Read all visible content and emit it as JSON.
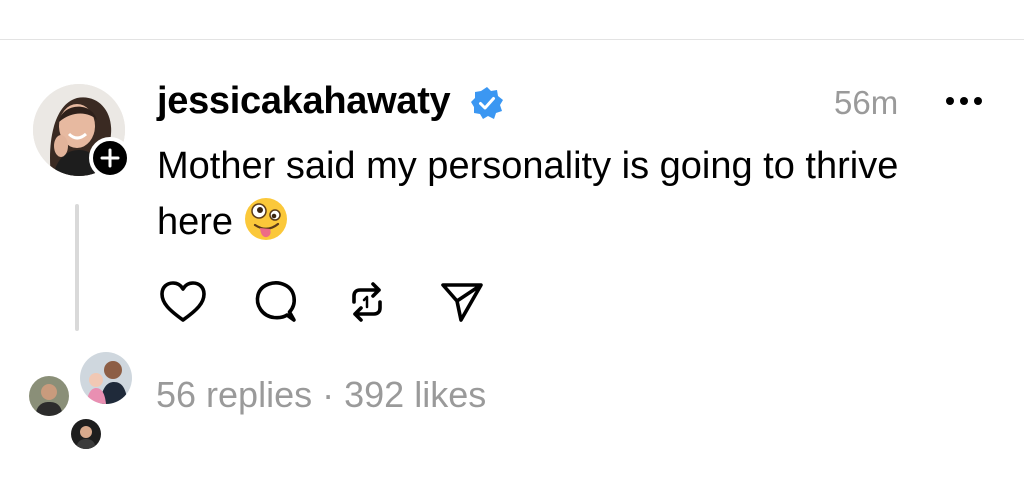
{
  "post": {
    "username": "jessicakahawaty",
    "verified": true,
    "timestamp": "56m",
    "text": "Mother said my personality is going to thrive here",
    "emoji": "zany-face"
  },
  "actions": [
    "like-icon",
    "comment-icon",
    "repost-icon",
    "share-icon"
  ],
  "stats": {
    "replies": "56 replies",
    "separator": "·",
    "likes": "392 likes"
  },
  "colors": {
    "verified_badge": "#3b97f2",
    "muted_text": "#9a9a9a",
    "thread_line": "#d9d9d9"
  }
}
